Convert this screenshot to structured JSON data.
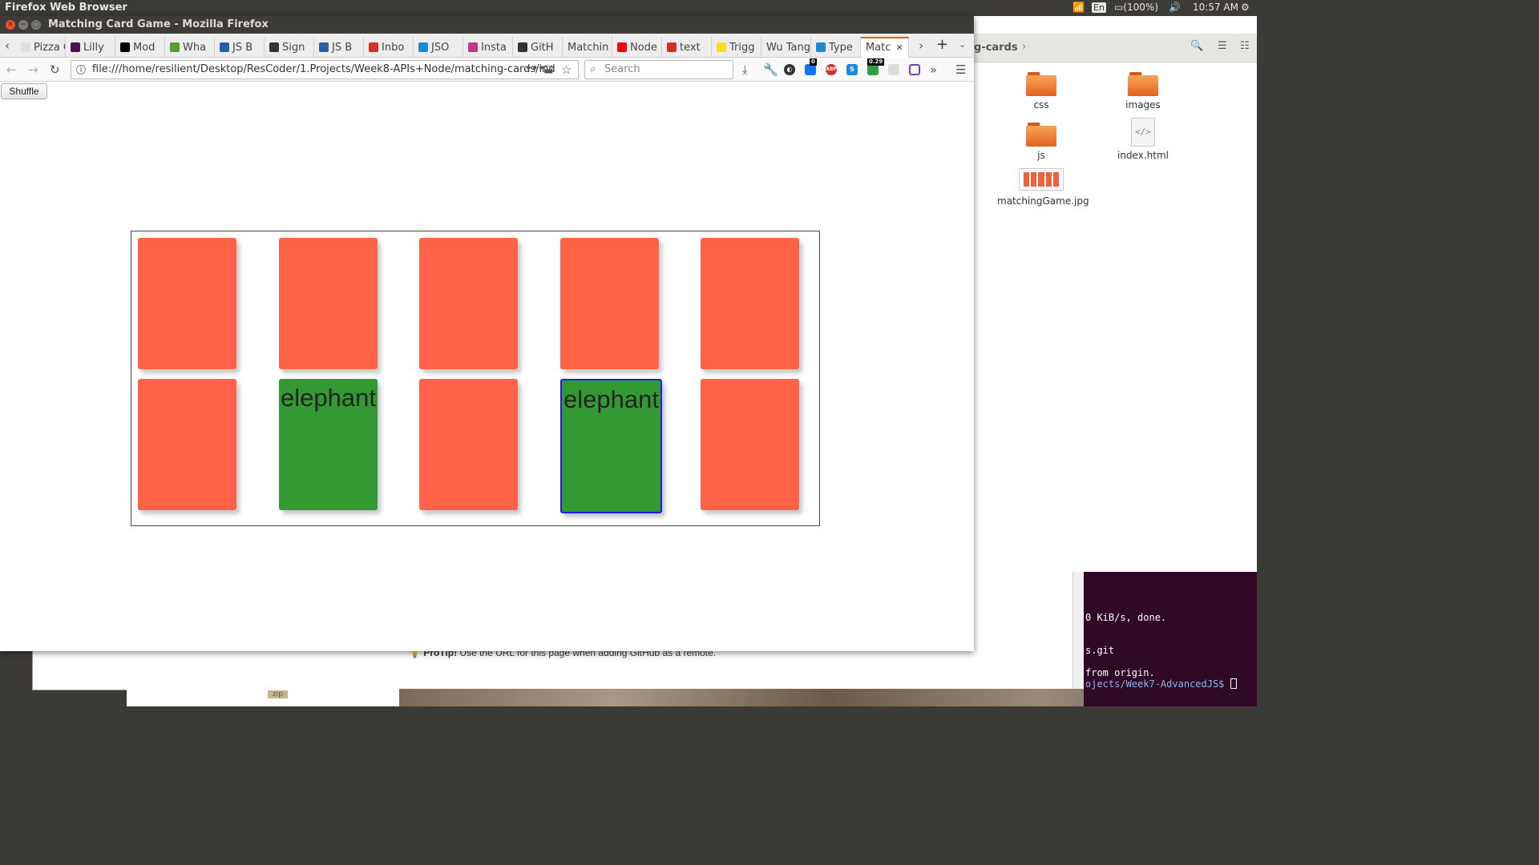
{
  "system_bar": {
    "app_title": "Firefox Web Browser",
    "language": "En",
    "battery": "(100%)",
    "time": "10:57 AM"
  },
  "window": {
    "title": "Matching Card Game - Mozilla Firefox"
  },
  "tabs": [
    {
      "label": "Pizza Cu",
      "icon": "pizza-icon",
      "color": "#e0e0e0"
    },
    {
      "label": "Lilly",
      "icon": "slack-icon",
      "color": "#4a154b"
    },
    {
      "label": "Mod",
      "icon": "medium-icon",
      "color": "#000000"
    },
    {
      "label": "Wha",
      "icon": "leaf-icon",
      "color": "#5a9a3a"
    },
    {
      "label": "JS B",
      "icon": "js-icon",
      "color": "#2b5ea7"
    },
    {
      "label": "Sign",
      "icon": "github-icon",
      "color": "#333333"
    },
    {
      "label": "JS B",
      "icon": "js-icon",
      "color": "#2b5ea7"
    },
    {
      "label": "Inbo",
      "icon": "gmail-icon",
      "color": "#d93025"
    },
    {
      "label": "JSO",
      "icon": "codepen-icon",
      "color": "#1a8ad6"
    },
    {
      "label": "Insta",
      "icon": "instagram-icon",
      "color": "#c13584"
    },
    {
      "label": "GitH",
      "icon": "github-icon",
      "color": "#333333"
    },
    {
      "label": "Matchin",
      "icon": "",
      "color": ""
    },
    {
      "label": "Node",
      "icon": "youtube-icon",
      "color": "#ff0000"
    },
    {
      "label": "text",
      "icon": "trello-icon",
      "color": "#d32f2f"
    },
    {
      "label": "Trigg",
      "icon": "js-yellow-icon",
      "color": "#f7df1e"
    },
    {
      "label": "Wu Tang",
      "icon": "",
      "color": ""
    },
    {
      "label": "Type",
      "icon": "codepen-icon",
      "color": "#1a8ad6"
    },
    {
      "label": "Matc",
      "icon": "",
      "color": "",
      "active": true
    }
  ],
  "nav": {
    "url": "file:///home/resilient/Desktop/ResCoder/1.Projects/Week8-APIs+Node/matching-cards/ind",
    "search_placeholder": "Search",
    "ext_badge_1": "0",
    "ext_badge_2": "0.29",
    "abp": "ABP"
  },
  "page": {
    "shuffle_label": "Shuffle",
    "cards": [
      {
        "label": "",
        "flipped": false,
        "selected": false
      },
      {
        "label": "",
        "flipped": false,
        "selected": false
      },
      {
        "label": "",
        "flipped": false,
        "selected": false
      },
      {
        "label": "",
        "flipped": false,
        "selected": false
      },
      {
        "label": "",
        "flipped": false,
        "selected": false
      },
      {
        "label": "",
        "flipped": false,
        "selected": false
      },
      {
        "label": "elephant",
        "flipped": true,
        "selected": false
      },
      {
        "label": "",
        "flipped": false,
        "selected": false
      },
      {
        "label": "elephant",
        "flipped": true,
        "selected": true
      },
      {
        "label": "",
        "flipped": false,
        "selected": false
      }
    ],
    "colors": {
      "card_back": "#ff6347",
      "card_match": "#339933",
      "selected_border": "#1a1aff"
    }
  },
  "file_manager": {
    "path_label": "g-cards",
    "items": [
      {
        "name": "css",
        "type": "folder"
      },
      {
        "name": "images",
        "type": "folder"
      },
      {
        "name": "js",
        "type": "folder"
      },
      {
        "name": "index.html",
        "type": "html"
      },
      {
        "name": "matchingGame.jpg",
        "type": "image"
      }
    ]
  },
  "background": {
    "protip": "Use the URL for this page when adding GitHub as a remote.",
    "protip_label": "ProTip!",
    "terminal_lines": [
      "0 KiB/s, done.",
      "s.git",
      "from origin.",
      "ojects/Week7-AdvancedJS$ "
    ],
    "zip_label": "zip"
  }
}
